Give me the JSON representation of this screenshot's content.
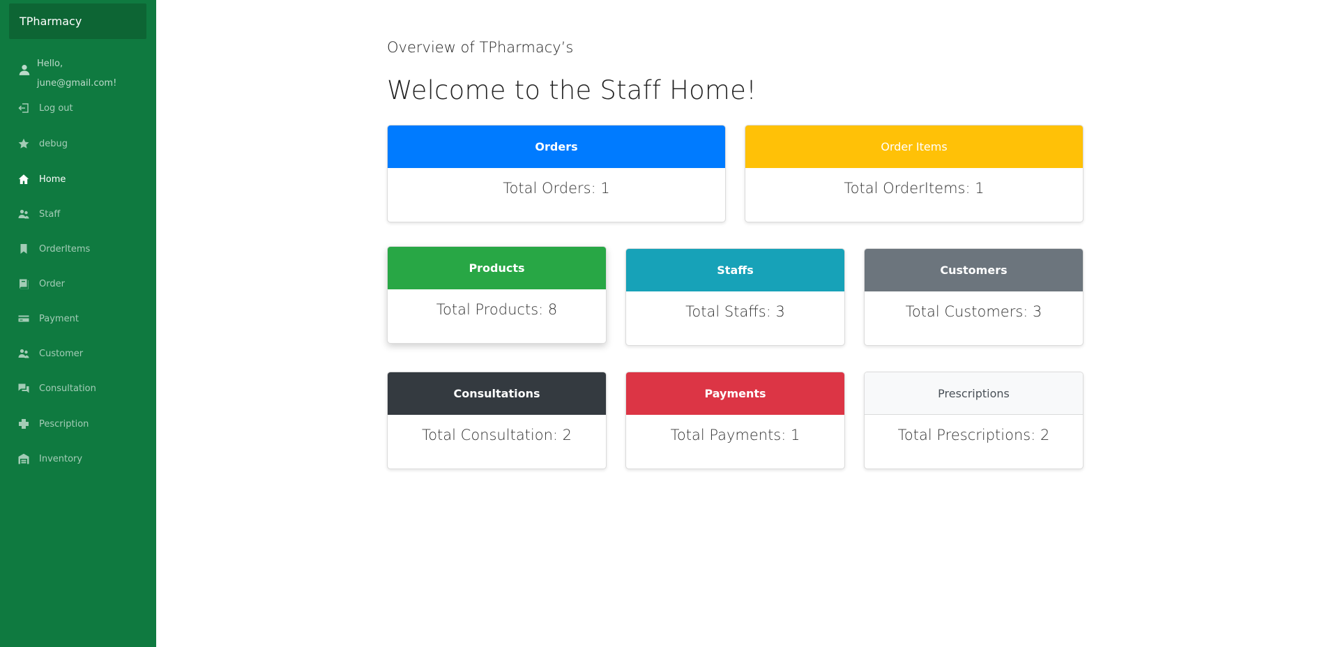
{
  "sidebar": {
    "brand": "TPharmacy",
    "greeting_line1": "Hello,",
    "greeting_line2": "june@gmail.com!",
    "items": [
      {
        "label": "Log out",
        "icon": "logout-icon",
        "active": false
      },
      {
        "label": "debug",
        "icon": "star-icon",
        "active": false
      },
      {
        "label": "Home",
        "icon": "home-icon",
        "active": true
      },
      {
        "label": "Staff",
        "icon": "users-icon",
        "active": false
      },
      {
        "label": "OrderItems",
        "icon": "bookmark-icon",
        "active": false
      },
      {
        "label": "Order",
        "icon": "book-icon",
        "active": false
      },
      {
        "label": "Payment",
        "icon": "credit-card-icon",
        "active": false
      },
      {
        "label": "Customer",
        "icon": "users-icon",
        "active": false
      },
      {
        "label": "Consultation",
        "icon": "chat-icon",
        "active": false
      },
      {
        "label": "Pescription",
        "icon": "plus-icon",
        "active": false
      },
      {
        "label": "Inventory",
        "icon": "warehouse-icon",
        "active": false
      }
    ]
  },
  "main": {
    "overview": "Overview of TPharmacy’s",
    "welcome": "Welcome to the Staff Home!",
    "cards": {
      "orders": {
        "title": "Orders",
        "body": "Total Orders: 1",
        "color": "#007bff"
      },
      "order_items": {
        "title": "Order Items",
        "body": "Total OrderItems: 1",
        "color": "#ffc107"
      },
      "products": {
        "title": "Products",
        "body": "Total Products: 8",
        "color": "#28a745"
      },
      "staffs": {
        "title": "Staffs",
        "body": "Total Staffs: 3",
        "color": "#17a2b8"
      },
      "customers": {
        "title": "Customers",
        "body": "Total Customers: 3",
        "color": "#6c757d"
      },
      "consultations": {
        "title": "Consultations",
        "body": "Total Consultation: 2",
        "color": "#343a40"
      },
      "payments": {
        "title": "Payments",
        "body": "Total Payments: 1",
        "color": "#dc3545"
      },
      "prescriptions": {
        "title": "Prescriptions",
        "body": "Total Prescriptions: 2",
        "color": "#f8f9fa"
      }
    }
  },
  "colors": {
    "sidebar_bg": "#0f7a40",
    "brand_bg": "#0d6534"
  }
}
